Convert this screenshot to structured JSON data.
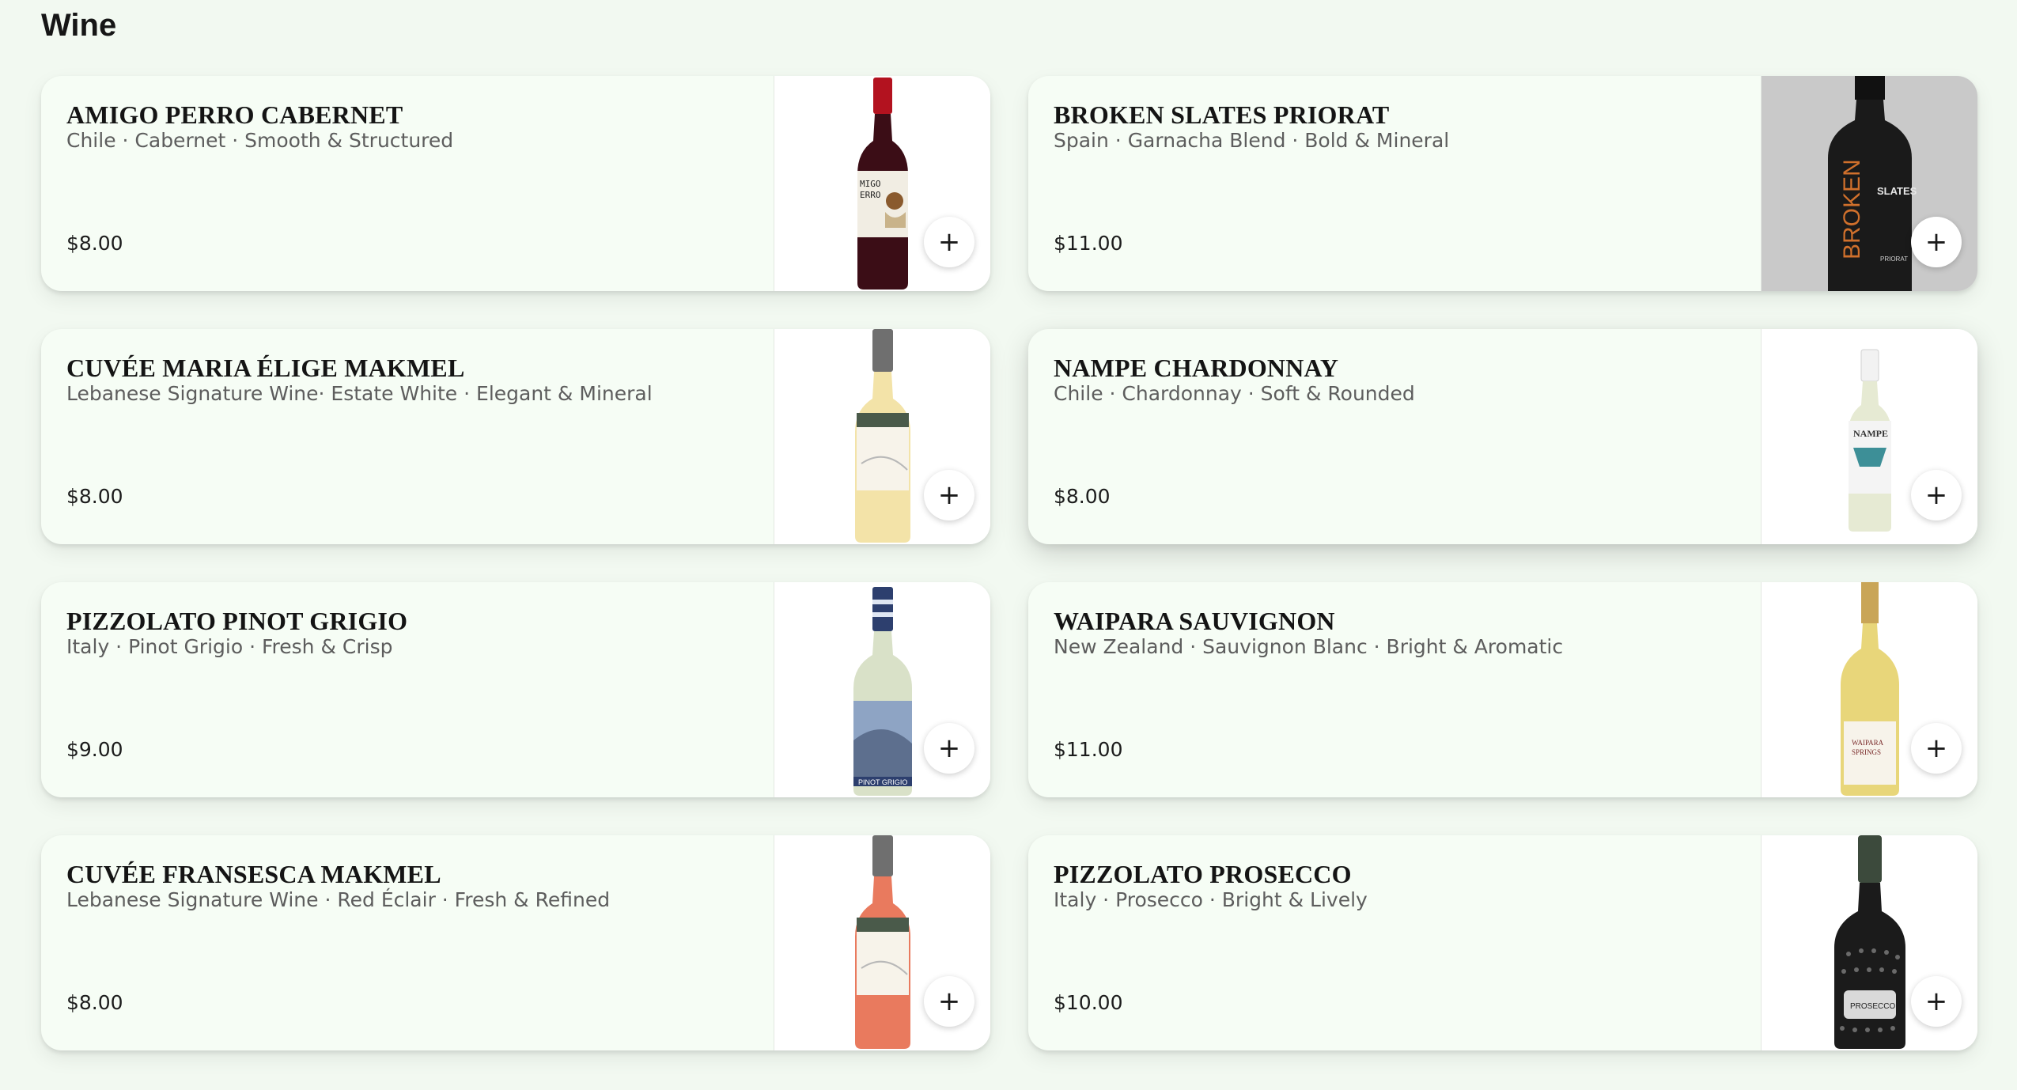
{
  "section": {
    "title": "Wine"
  },
  "add_label": "+",
  "items": [
    {
      "name": "AMIGO PERRO CABERNET",
      "desc": "Chile · Cabernet · Smooth & Structured",
      "price": "$8.00",
      "bottle": "red-wine-bottle-image"
    },
    {
      "name": "BROKEN SLATES PRIORAT",
      "desc": "Spain · Garnacha Blend · Bold & Mineral",
      "price": "$11.00",
      "bottle": "dark-wine-bottle-image"
    },
    {
      "name": "CUVÉE MARIA ÉLIGE MAKMEL",
      "desc": "Lebanese Signature Wine· Estate White · Elegant & Mineral",
      "price": "$8.00",
      "bottle": "white-wine-bottle-image"
    },
    {
      "name": "NAMPE CHARDONNAY",
      "desc": "Chile · Chardonnay · Soft & Rounded",
      "price": "$8.00",
      "bottle": "white-wine-bottle-image"
    },
    {
      "name": "PIZZOLATO PINOT GRIGIO",
      "desc": "Italy · Pinot Grigio · Fresh & Crisp",
      "price": "$9.00",
      "bottle": "white-wine-bottle-image"
    },
    {
      "name": "WAIPARA SAUVIGNON",
      "desc": "New Zealand · Sauvignon Blanc · Bright & Aromatic",
      "price": "$11.00",
      "bottle": "white-wine-bottle-image"
    },
    {
      "name": "CUVÉE FRANSESCA MAKMEL",
      "desc": "Lebanese Signature Wine · Red Éclair · Fresh & Refined",
      "price": "$8.00",
      "bottle": "rose-wine-bottle-image"
    },
    {
      "name": "PIZZOLATO PROSECCO",
      "desc": "Italy · Prosecco · Bright & Lively",
      "price": "$10.00",
      "bottle": "sparkling-wine-bottle-image"
    }
  ]
}
